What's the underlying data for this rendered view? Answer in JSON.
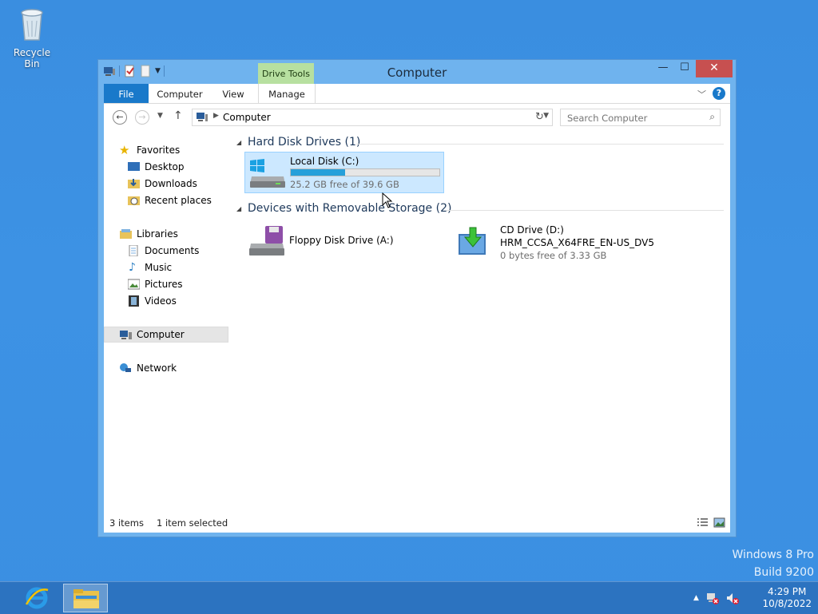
{
  "desktop": {
    "recycle_bin_label": "Recycle Bin"
  },
  "window": {
    "title": "Computer",
    "contextual_tab_group": "Drive Tools",
    "close_glyph": "✕",
    "minimize_glyph": "—",
    "maximize_glyph": "☐"
  },
  "ribbon": {
    "tabs": [
      {
        "label": "File"
      },
      {
        "label": "Computer"
      },
      {
        "label": "View"
      },
      {
        "label": "Manage"
      }
    ]
  },
  "address": {
    "crumb": "Computer",
    "search_placeholder": "Search Computer"
  },
  "nav_pane": {
    "favorites": "Favorites",
    "desktop": "Desktop",
    "downloads": "Downloads",
    "recent": "Recent places",
    "libraries": "Libraries",
    "documents": "Documents",
    "music": "Music",
    "pictures": "Pictures",
    "videos": "Videos",
    "computer": "Computer",
    "network": "Network"
  },
  "groups": {
    "hard_disk": {
      "header": "Hard Disk Drives (1)",
      "drives": [
        {
          "name": "Local Disk (C:)",
          "space": "25.2 GB free of 39.6 GB",
          "used_fraction": 0.364
        }
      ]
    },
    "removable": {
      "header": "Devices with Removable Storage (2)",
      "devices": [
        {
          "name": "Floppy Disk Drive (A:)"
        },
        {
          "name": "CD Drive (D:)",
          "label": "HRM_CCSA_X64FRE_EN-US_DV5",
          "space": "0 bytes free of 3.33 GB"
        }
      ]
    }
  },
  "status": {
    "items": "3 items",
    "selected": "1 item selected"
  },
  "watermark": {
    "line1": "Windows 8 Pro",
    "line2": "Build 9200"
  },
  "clock": {
    "time": "4:29 PM",
    "date": "10/8/2022"
  },
  "colors": {
    "accent": "#1979ca",
    "selection": "#cce8ff",
    "drive_bar": "#26a0da"
  }
}
